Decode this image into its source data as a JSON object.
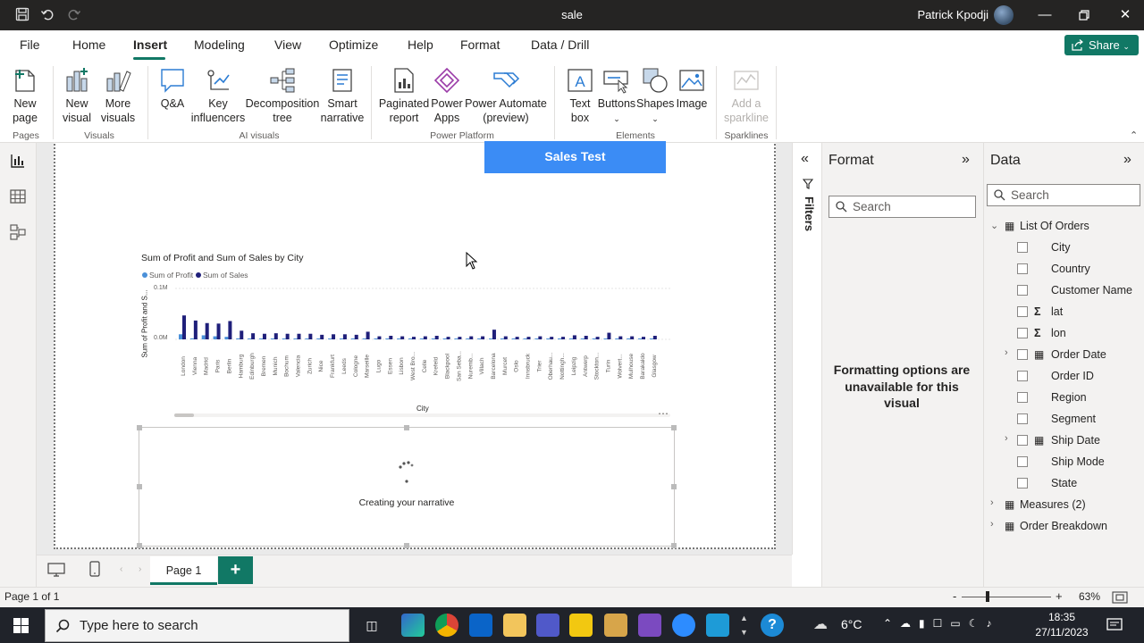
{
  "window": {
    "title": "sale",
    "user": "Patrick Kpodji"
  },
  "menu_tabs": [
    {
      "label": "File"
    },
    {
      "label": "Home"
    },
    {
      "label": "Insert"
    },
    {
      "label": "Modeling"
    },
    {
      "label": "View"
    },
    {
      "label": "Optimize"
    },
    {
      "label": "Help"
    },
    {
      "label": "Format"
    },
    {
      "label": "Data / Drill"
    }
  ],
  "active_tab": "Insert",
  "share_label": "Share",
  "ribbon": {
    "new_page": "New page",
    "new_visual": "New visual",
    "more_visuals": "More visuals",
    "qa": "Q&A",
    "key_influencers": "Key influencers",
    "decomposition_tree": "Decomposition tree",
    "smart_narrative": "Smart narrative",
    "paginated_report": "Paginated report",
    "power_apps": "Power Apps",
    "power_automate": "Power Automate (preview)",
    "text_box": "Text box",
    "buttons": "Buttons",
    "shapes": "Shapes",
    "image": "Image",
    "add_sparkline": "Add a sparkline",
    "groups": {
      "pages": "Pages",
      "visuals": "Visuals",
      "ai_visuals": "AI visuals",
      "power_platform": "Power Platform",
      "elements": "Elements",
      "sparklines": "Sparklines"
    }
  },
  "canvas": {
    "title_button": "Sales Test",
    "narrative_status": "Creating your narrative"
  },
  "chart_data": {
    "type": "bar",
    "title": "Sum of Profit and Sum of Sales by City",
    "xlabel": "City",
    "ylabel": "Sum of Profit and S...",
    "yticks": [
      "0.1M",
      "0.0M"
    ],
    "ylim": [
      0,
      0.1
    ],
    "legend_position": "top-left",
    "categories": [
      "London",
      "Vienna",
      "Madrid",
      "Paris",
      "Berlin",
      "Hamburg",
      "Edinburgh",
      "Bremen",
      "Munich",
      "Bochum",
      "Valencia",
      "Zurich",
      "Nice",
      "Frankfurt",
      "Leeds",
      "Cologne",
      "Marseille",
      "Lugo",
      "Essen",
      "Lisbon",
      "West Bro...",
      "Celle",
      "Krefeld",
      "Blackpool",
      "San Seba...",
      "Nuremb...",
      "Villach",
      "Barcelona",
      "Murcet",
      "Oslo",
      "Innsbruck",
      "Trier",
      "Oberhau...",
      "Nottingh...",
      "Leipzig",
      "Antwerp",
      "Stockton...",
      "Turin",
      "Wolvert...",
      "Mulhouse",
      "Barakaldo",
      "Glasgow"
    ],
    "series": [
      {
        "name": "Sum of Profit",
        "color": "#4a90d9",
        "values": [
          0.01,
          0.002,
          0.008,
          0.006,
          0.005,
          0.002,
          0.001,
          0.001,
          0.001,
          0.001,
          0.001,
          0.001,
          0.001,
          0.001,
          0.001,
          0.001,
          0.001,
          0.001,
          0.001,
          0.001,
          0.001,
          0.001,
          0.0005,
          0.0005,
          0.0005,
          0.0005,
          0.0005,
          0.001,
          0.0005,
          0.0005,
          0.0005,
          0.0005,
          0.0005,
          0.0005,
          0.0005,
          0.0005,
          0.0005,
          0.0005,
          0.0005,
          0.0005,
          0.0005,
          0.0005
        ]
      },
      {
        "name": "Sum of Sales",
        "color": "#1f1f7a",
        "values": [
          0.047,
          0.037,
          0.032,
          0.031,
          0.036,
          0.017,
          0.012,
          0.011,
          0.012,
          0.011,
          0.011,
          0.011,
          0.009,
          0.01,
          0.01,
          0.009,
          0.015,
          0.006,
          0.007,
          0.006,
          0.005,
          0.006,
          0.007,
          0.005,
          0.005,
          0.006,
          0.006,
          0.019,
          0.006,
          0.005,
          0.005,
          0.006,
          0.005,
          0.005,
          0.008,
          0.007,
          0.005,
          0.013,
          0.006,
          0.006,
          0.005,
          0.007
        ]
      }
    ]
  },
  "filters_label": "Filters",
  "format_pane": {
    "title": "Format",
    "search_placeholder": "Search",
    "message": "Formatting options are unavailable for this visual"
  },
  "data_pane": {
    "title": "Data",
    "search_placeholder": "Search",
    "table_name": "List Of Orders",
    "fields": [
      {
        "label": "City",
        "sigma": false,
        "calendar": false,
        "expandable": false
      },
      {
        "label": "Country",
        "sigma": false,
        "calendar": false,
        "expandable": false
      },
      {
        "label": "Customer Name",
        "sigma": false,
        "calendar": false,
        "expandable": false
      },
      {
        "label": "lat",
        "sigma": true,
        "calendar": false,
        "expandable": false
      },
      {
        "label": "lon",
        "sigma": true,
        "calendar": false,
        "expandable": false
      },
      {
        "label": "Order Date",
        "sigma": false,
        "calendar": true,
        "expandable": true
      },
      {
        "label": "Order ID",
        "sigma": false,
        "calendar": false,
        "expandable": false
      },
      {
        "label": "Region",
        "sigma": false,
        "calendar": false,
        "expandable": false
      },
      {
        "label": "Segment",
        "sigma": false,
        "calendar": false,
        "expandable": false
      },
      {
        "label": "Ship Date",
        "sigma": false,
        "calendar": true,
        "expandable": true
      },
      {
        "label": "Ship Mode",
        "sigma": false,
        "calendar": false,
        "expandable": false
      },
      {
        "label": "State",
        "sigma": false,
        "calendar": false,
        "expandable": false
      }
    ],
    "other_tables": [
      "Measures (2)",
      "Order Breakdown"
    ]
  },
  "page_tabs": {
    "current": "Page 1",
    "add_label": "+"
  },
  "status": {
    "page_indicator": "Page 1 of 1",
    "zoom": "63%",
    "zoom_minus": "-",
    "zoom_plus": "+"
  },
  "taskbar": {
    "search_placeholder": "Type here to search",
    "weather": "6°C",
    "time": "18:35",
    "date": "27/11/2023"
  }
}
